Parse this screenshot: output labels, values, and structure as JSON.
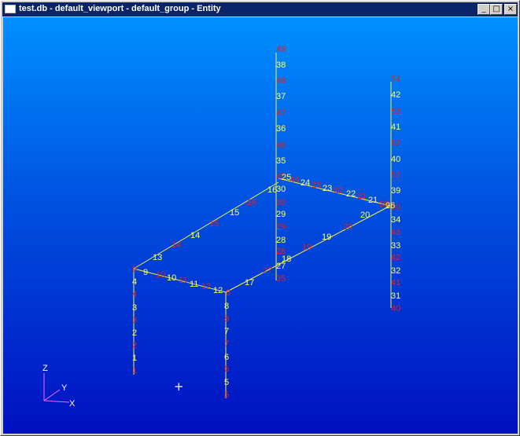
{
  "window": {
    "title": "test.db - default_viewport - default_group - Entity",
    "icon": "app-window-icon",
    "buttons": {
      "minimize": "_",
      "maximize": "□",
      "close": "×"
    }
  },
  "colors": {
    "title_bar": "#0a246a",
    "viewport_top": "#0090ff",
    "viewport_bottom": "#0010c0",
    "element_line": "#f0f040",
    "node_label": "#ffff60",
    "element_label": "#e02020",
    "triad": "#ff60ff"
  },
  "triad": {
    "x_label": "X",
    "y_label": "Y",
    "z_label": "Z"
  },
  "cursor": {
    "glyph": "+"
  },
  "labels": {
    "n49": "49",
    "n38": "38",
    "n48": "48",
    "n37": "37",
    "n47": "47",
    "n36": "36",
    "n46": "46",
    "n35": "35",
    "n45": "45",
    "n25": "25",
    "n44": "44",
    "n24": "24",
    "n23": "23",
    "n22": "22",
    "n21": "21",
    "n26": "26",
    "n20": "20",
    "n19": "19",
    "n30": "30",
    "n29": "29",
    "n28": "28",
    "n27": "27",
    "n18": "18",
    "n17": "17",
    "n16": "16",
    "n15": "15",
    "n14": "14",
    "n13": "13",
    "n12": "12",
    "n11": "11",
    "n10": "10",
    "n9": "9",
    "n8": "8",
    "n7": "7",
    "n6": "6",
    "n5": "5",
    "n4": "4",
    "n3": "3",
    "n2": "2",
    "n1": "1",
    "n54": "54",
    "n42": "42",
    "n53": "53",
    "n41": "41",
    "n52": "52",
    "n40": "40",
    "n51": "51",
    "n39": "39",
    "n34": "34",
    "n43": "43",
    "n33": "33",
    "n32": "32",
    "n31": "31",
    "n50": "50"
  }
}
